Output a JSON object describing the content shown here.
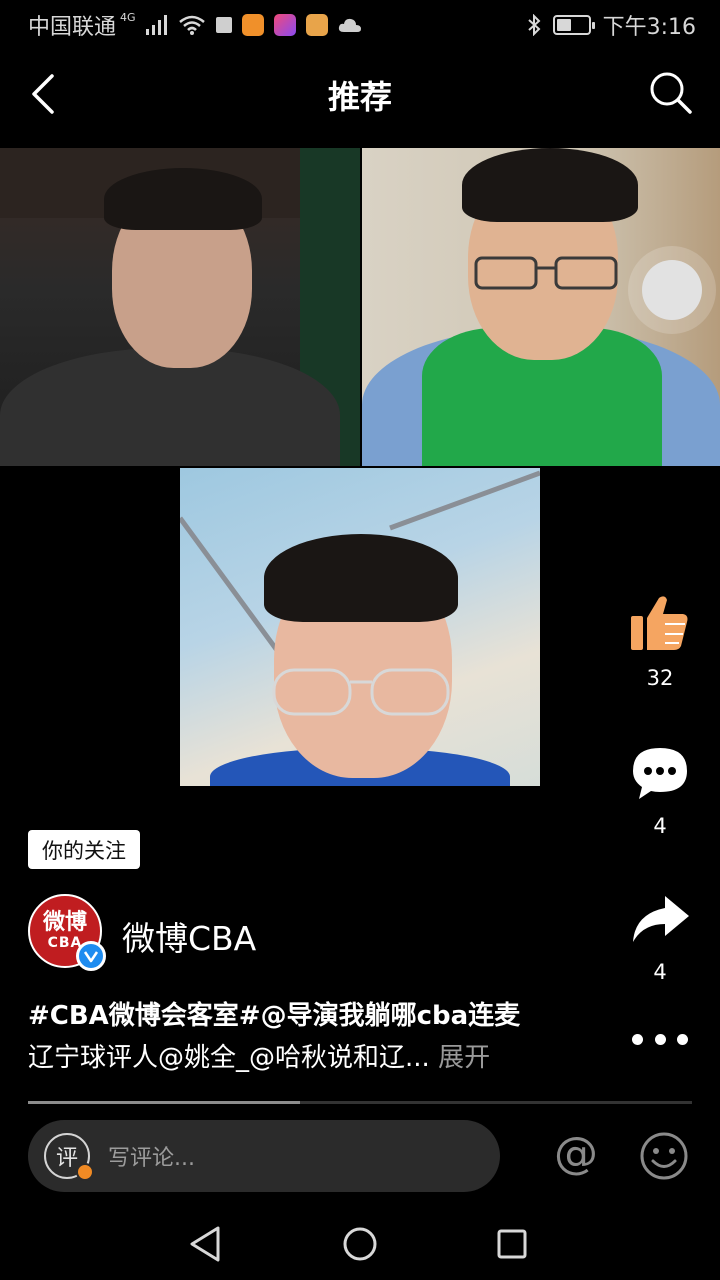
{
  "status_bar": {
    "carrier": "中国联通",
    "network": "4G",
    "time": "下午3:16",
    "battery_level": 0.55
  },
  "nav": {
    "title": "推荐"
  },
  "actions": {
    "likes": "32",
    "comments": "4",
    "shares": "4"
  },
  "follow_tag": "你的关注",
  "author": {
    "name": "微博CBA",
    "avatar_text_top": "微博",
    "avatar_text_bottom": "CBA"
  },
  "caption": {
    "line1": "#CBA微博会客室#@导演我躺哪cba连麦",
    "line2": "辽宁球评人@姚全_@哈秋说和辽...",
    "expand": "展开"
  },
  "progress": 0.41,
  "comment_bar": {
    "badge": "评",
    "placeholder": "写评论...",
    "at_symbol": "@"
  },
  "colors": {
    "background": "#000000",
    "like_icon": "#f5a561",
    "verified": "#1e8cf0",
    "avatar_bg": "#c01d20"
  }
}
